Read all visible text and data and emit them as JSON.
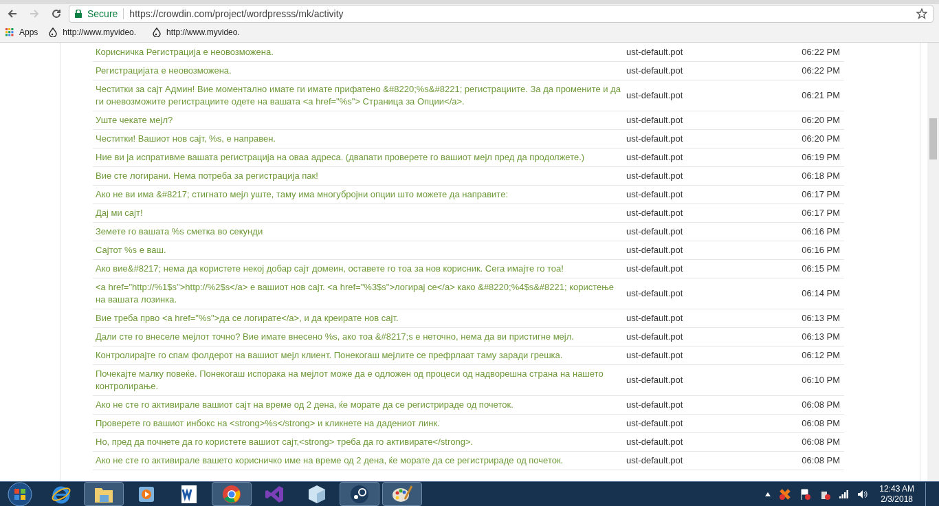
{
  "browser": {
    "nav": [
      {
        "kind": "back",
        "disabled": false
      },
      {
        "kind": "forward",
        "disabled": true
      },
      {
        "kind": "reload",
        "disabled": false
      }
    ],
    "security": "Secure",
    "url": "https://crowdin.com/project/wordpresss/mk/activity",
    "bookmarks": [
      {
        "kind": "apps",
        "label": "Apps"
      },
      {
        "kind": "site",
        "label": "http://www.myvideo."
      },
      {
        "kind": "site",
        "label": "http://www.myvideo."
      }
    ]
  },
  "activity": [
    {
      "text": "Корисничка Регистрација е неовозможена.",
      "file": "ust-default.pot",
      "time": "06:22 PM"
    },
    {
      "text": "Регистрацијата е неовозможена.",
      "file": "ust-default.pot",
      "time": "06:22 PM"
    },
    {
      "text": "Честитки за сајт Админ! Вие моментално имате ги имате прифатено &#8220;%s&#8221; регистрациите. За да промените и да ги оневозможите регистрациите одете на вашата <a href=\"%s\"> Страница за Опции</a>.",
      "file": "ust-default.pot",
      "time": "06:21 PM"
    },
    {
      "text": "Уште чекате мејл?",
      "file": "ust-default.pot",
      "time": "06:20 PM"
    },
    {
      "text": "Честитки! Вашиот нов сајт, %s, е направен.",
      "file": "ust-default.pot",
      "time": "06:20 PM"
    },
    {
      "text": "Ние ви ја испративме вашата регистрација на оваа адреса. (двапати проверете го вашиот мејл пред да продолжете.)",
      "file": "ust-default.pot",
      "time": "06:19 PM"
    },
    {
      "text": "Вие сте логирани. Нема потреба за регистрација пак!",
      "file": "ust-default.pot",
      "time": "06:18 PM"
    },
    {
      "text": "Ако не ви има &#8217; стигнато мејл уште, таму има многубројни опции што можете да направите:",
      "file": "ust-default.pot",
      "time": "06:17 PM"
    },
    {
      "text": "Дај ми сајт!",
      "file": "ust-default.pot",
      "time": "06:17 PM"
    },
    {
      "text": "Земете го вашата %s сметка во секунди",
      "file": "ust-default.pot",
      "time": "06:16 PM"
    },
    {
      "text": "Сајтот %s е ваш.",
      "file": "ust-default.pot",
      "time": "06:16 PM"
    },
    {
      "text": "Ако вие&#8217; нема да користете некој добар сајт домеин, оставете го тоа за нов корисник. Сега имајте го тоа!",
      "file": "ust-default.pot",
      "time": "06:15 PM"
    },
    {
      "text": "<a href=\"http://%1$s\">http://%2$s</a> е вашиот нов сајт. <a href=\"%3$s\">логирај се</a> како &#8220;%4$s&#8221; користење на вашата лозинка.",
      "file": "ust-default.pot",
      "time": "06:14 PM"
    },
    {
      "text": "Вие треба прво <a href=\"%s\">да се логирате</a>, и да креирате нов сајт.",
      "file": "ust-default.pot",
      "time": "06:13 PM"
    },
    {
      "text": "Дали сте го внеселе мејлот точно? Вие имате внесено %s, ако тоа &#8217;s е неточно, нема да ви пристигне мејл.",
      "file": "ust-default.pot",
      "time": "06:13 PM"
    },
    {
      "text": "Контролирајте го спам фолдерот на вашиот мејл клиент. Понекогаш мејлите се префрлаат таму заради грешка.",
      "file": "ust-default.pot",
      "time": "06:12 PM"
    },
    {
      "text": "Почекајте малку повеќе. Понекогаш испорака на мејлот може да е одложен од процеси од надворешна страна на нашето контролирање.",
      "file": "ust-default.pot",
      "time": "06:10 PM"
    },
    {
      "text": "Ако не сте го активирале вашиот сајт на време од 2 дена, ќе морате да се регистрираде од почеток.",
      "file": "ust-default.pot",
      "time": "06:08 PM"
    },
    {
      "text": "Проверете го вашиот инбокс на <strong>%s</strong> и кликнете на дадениот линк.",
      "file": "ust-default.pot",
      "time": "06:08 PM"
    },
    {
      "text": "Но, пред да почнете да го користете вашиот сајт,<strong> треба да го активирате</strong>.",
      "file": "ust-default.pot",
      "time": "06:08 PM"
    },
    {
      "text": "Ако не сте го активирале вашето корисничко име на време од 2 дена, ќе морате да се регистрираде од почеток.",
      "file": "ust-default.pot",
      "time": "06:08 PM"
    }
  ],
  "taskbar": [
    {
      "kind": "start",
      "running": false
    },
    {
      "kind": "ie",
      "running": false
    },
    {
      "kind": "explorer",
      "running": true
    },
    {
      "kind": "media",
      "running": false
    },
    {
      "kind": "word",
      "running": false
    },
    {
      "kind": "chrome",
      "running": true
    },
    {
      "kind": "vs",
      "running": false
    },
    {
      "kind": "cube",
      "running": false
    },
    {
      "kind": "steam",
      "running": true
    },
    {
      "kind": "paint",
      "running": true
    }
  ],
  "clock": {
    "time": "12:43 AM",
    "date": "2/3/2018"
  }
}
